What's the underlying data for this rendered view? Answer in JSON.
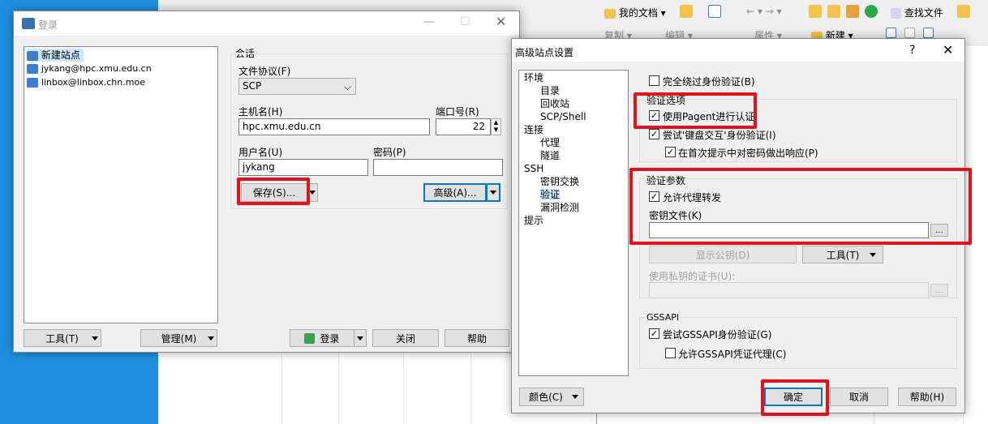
{
  "bg_toolbar": {
    "row1_left_label": "我的文档",
    "row1_right_label": "我的文档",
    "find_files": "查找文件",
    "copy": "复制",
    "edit": "编辑",
    "properties": "属性",
    "new": "新建"
  },
  "login": {
    "title": "登录",
    "sites": [
      "新建站点",
      "jykang@hpc.xmu.edu.cn",
      "linbox@linbox.chn.moe"
    ],
    "session_label": "会话",
    "protocol_label": "文件协议(F)",
    "protocol_value": "SCP",
    "host_label": "主机名(H)",
    "host_value": "hpc.xmu.edu.cn",
    "port_label": "端口号(R)",
    "port_value": "22",
    "user_label": "用户名(U)",
    "user_value": "jykang",
    "password_label": "密码(P)",
    "password_value": "",
    "save_btn": "保存(S)...",
    "advanced_btn": "高级(A)...",
    "tools_btn": "工具(T)",
    "manage_btn": "管理(M)",
    "login_btn": "登录",
    "close_btn": "关闭",
    "help_btn": "帮助"
  },
  "advanced": {
    "title": "高级站点设置",
    "help_q": "?",
    "tree": [
      {
        "label": "环境",
        "level": 0
      },
      {
        "label": "目录",
        "level": 1
      },
      {
        "label": "回收站",
        "level": 1
      },
      {
        "label": "SCP/Shell",
        "level": 1
      },
      {
        "label": "连接",
        "level": 0
      },
      {
        "label": "代理",
        "level": 1
      },
      {
        "label": "隧道",
        "level": 1
      },
      {
        "label": "SSH",
        "level": 0
      },
      {
        "label": "密钥交换",
        "level": 1
      },
      {
        "label": "验证",
        "level": 1
      },
      {
        "label": "漏洞检测",
        "level": 1
      },
      {
        "label": "提示",
        "level": 0
      }
    ],
    "bypass_auth": "完全绕过身份验证(B)",
    "auth_options_group": "验证选项",
    "use_pageant": "使用Pagent进行认证",
    "try_keyboard": "尝试'键盘交互'身份验证(I)",
    "respond_first_prompt": "在首次提示中对密码做出响应(P)",
    "auth_params_group": "验证参数",
    "allow_agent_forwarding": "允许代理转发",
    "key_file_label": "密钥文件(K)",
    "key_file_value": "",
    "browse": "...",
    "show_pubkey": "显示公钥(D)",
    "tools_btn": "工具(T)",
    "cert_label": "使用私钥的证书(U):",
    "gssapi_group": "GSSAPI",
    "try_gssapi": "尝试GSSAPI身份验证(G)",
    "allow_gssapi_delegation": "允许GSSAPI凭证代理(C)",
    "color_btn": "颜色(C)",
    "ok_btn": "确定",
    "cancel_btn": "取消",
    "help_btn": "帮助(H)"
  }
}
